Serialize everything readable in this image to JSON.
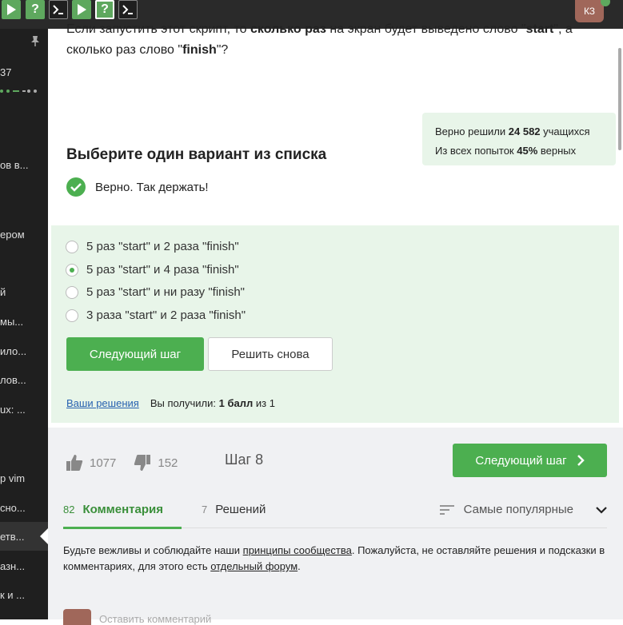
{
  "topbar": {
    "step_icons": [
      "play",
      "question",
      "terminal",
      "play",
      "question",
      "terminal"
    ],
    "user_initials": "КЗ"
  },
  "sidebar": {
    "progress_text": "37",
    "items": [
      "ов в...",
      "ером",
      "й",
      "мы...",
      "ило...",
      "лов...",
      "ux: ...",
      "p vim",
      "сно...",
      "етв...",
      "азн...",
      "к и ..."
    ]
  },
  "question": {
    "part1": "Если запустить этот скрипт, то ",
    "bold1": "сколько раз",
    "part2": " на экран будет выведено слово \"",
    "bold2": "start",
    "part3": "\", а сколько раз слово \"",
    "bold3": "finish",
    "part4": "\"?"
  },
  "stats": {
    "line1_prefix": "Верно решили ",
    "line1_value": "24 582",
    "line1_suffix": " учащихся",
    "line2_prefix": "Из всех попыток ",
    "line2_value": "45%",
    "line2_suffix": " верных"
  },
  "heading": "Выберите один вариант из списка",
  "result_text": "Верно. Так держать!",
  "options": [
    {
      "label": "5 раз \"start\" и 2 раза \"finish\"",
      "selected": false
    },
    {
      "label": "5 раз \"start\" и 4 раза \"finish\"",
      "selected": true
    },
    {
      "label": "5 раз \"start\" и ни разу \"finish\"",
      "selected": false
    },
    {
      "label": "3 раза \"start\" и 2 раза \"finish\"",
      "selected": false
    }
  ],
  "buttons": {
    "next": "Следующий шаг",
    "again": "Решить снова"
  },
  "solutions": {
    "link": "Ваши решения",
    "prefix": "Вы получили: ",
    "score": "1 балл",
    "suffix": " из 1"
  },
  "footer": {
    "likes": "1077",
    "dislikes": "152",
    "step": "Шаг 8",
    "next_button": "Следующий шаг"
  },
  "tabs": {
    "comments_count": "82",
    "comments_label": "Комментария",
    "solutions_count": "7",
    "solutions_label": "Решений",
    "sort_label": "Самые популярные"
  },
  "notice": {
    "p1": "Будьте вежливы и соблюдайте наши ",
    "link1": "принципы сообщества",
    "p2": ". Пожалуйста, не оставляйте решения и подсказки в комментариях, для этого есть ",
    "link2": "отдельный форум",
    "p3": "."
  },
  "comment_placeholder": "Оставить комментарий",
  "colors": {
    "accent": "#4caf50",
    "answer_bg": "#e8f5e9",
    "sidebar_bg": "#1f1f1f"
  }
}
